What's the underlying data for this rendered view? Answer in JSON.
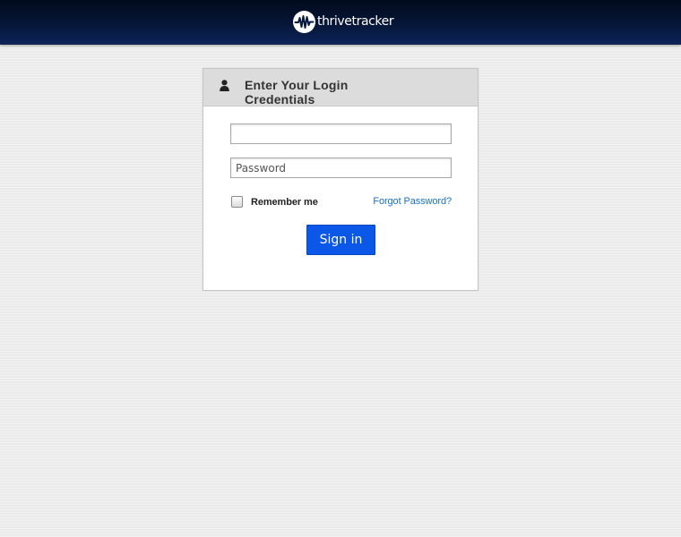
{
  "header": {
    "logo_text": "thrivetracker",
    "logo_icon": "pulse-logo-icon"
  },
  "login": {
    "user_icon": "user-icon",
    "title": "Enter Your Login Credentials",
    "username_value": "",
    "username_placeholder": "",
    "password_value": "",
    "password_placeholder": "Password",
    "remember_label": "Remember me",
    "remember_checked": false,
    "forgot_label": "Forgot Password?",
    "signin_label": "Sign in"
  },
  "colors": {
    "header_bg": "#061637",
    "button_bg": "#0a57e8",
    "link": "#1a6ec7",
    "page_bg": "#ebebeb"
  }
}
